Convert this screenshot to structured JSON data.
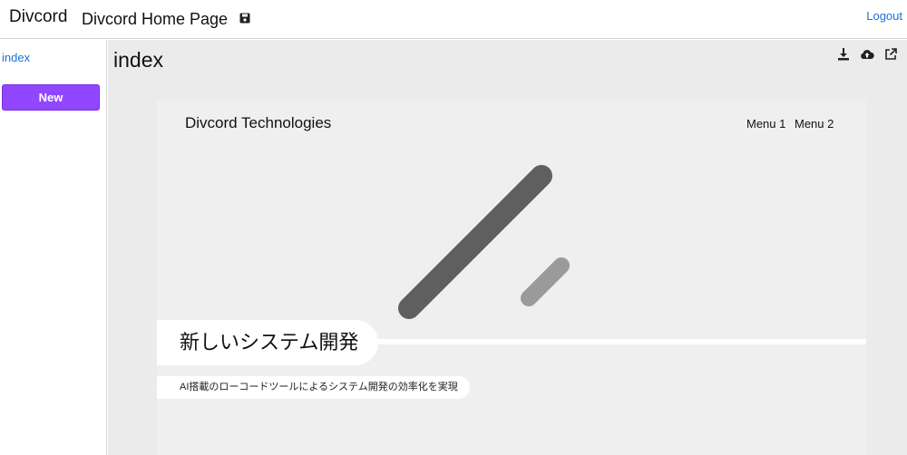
{
  "header": {
    "brand": "Divcord",
    "page_name": "Divcord Home Page",
    "logout": "Logout"
  },
  "sidebar": {
    "items": [
      {
        "label": "index"
      }
    ],
    "new_button": "New"
  },
  "main": {
    "title": "index",
    "tools": [
      "download-icon",
      "cloud-upload-icon",
      "external-link-icon"
    ]
  },
  "preview": {
    "brand": "Divcord Technologies",
    "menu": [
      "Menu 1",
      "Menu 2"
    ],
    "hero_title": "新しいシステム開発",
    "hero_subtitle": "AI搭載のローコードツールによるシステム開発の効率化を実現"
  },
  "colors": {
    "accent": "#9146ff",
    "link": "#1d6fd6",
    "canvas": "#ebebeb",
    "art_dark": "#5f5f5f",
    "art_light": "#9a9a9a"
  }
}
